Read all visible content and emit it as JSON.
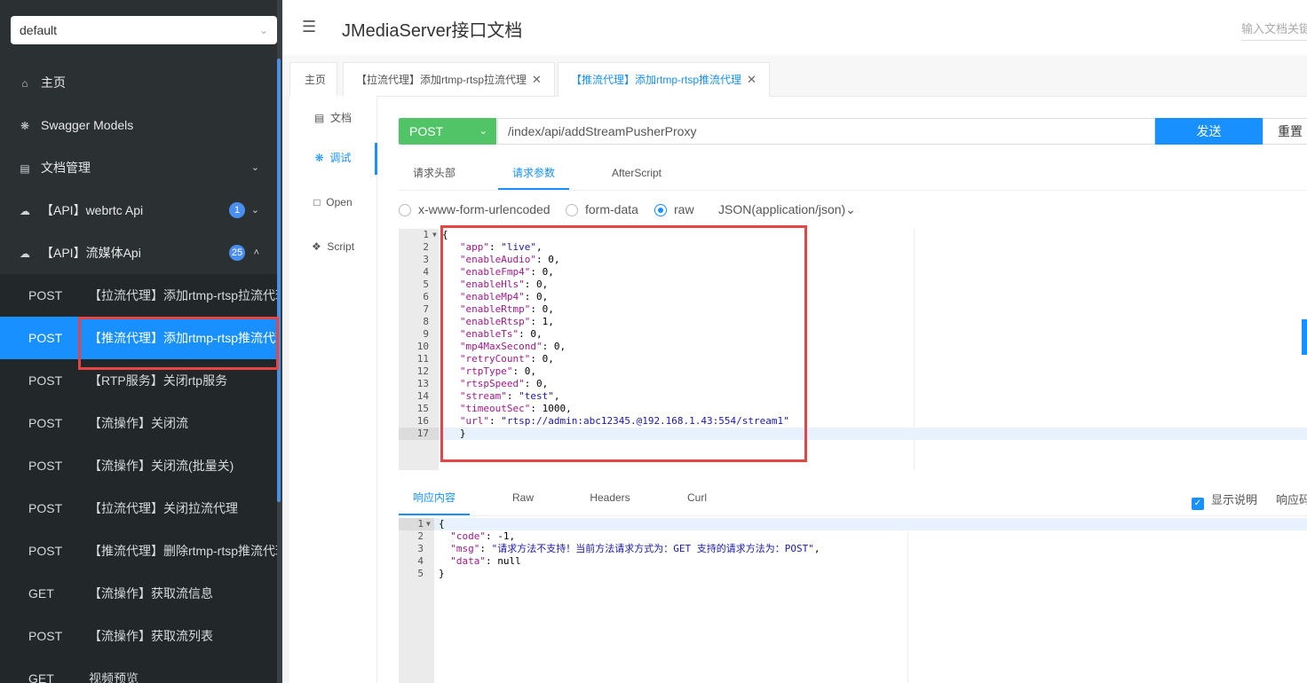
{
  "sidebar": {
    "group_select": "default",
    "menu": [
      {
        "label": "主页",
        "icon": "home-icon"
      },
      {
        "label": "Swagger Models",
        "icon": "cube-icon"
      },
      {
        "label": "文档管理",
        "icon": "doc-manage-icon"
      },
      {
        "label": "【API】webrtc Api",
        "icon": "cloud-icon",
        "badge": "1"
      },
      {
        "label": "【API】流媒体Api",
        "icon": "cloud-icon",
        "badge": "25"
      }
    ],
    "apis": [
      {
        "method": "POST",
        "name": "【拉流代理】添加rtmp-rtsp拉流代理"
      },
      {
        "method": "POST",
        "name": "【推流代理】添加rtmp-rtsp推流代理"
      },
      {
        "method": "POST",
        "name": "【RTP服务】关闭rtp服务"
      },
      {
        "method": "POST",
        "name": "【流操作】关闭流"
      },
      {
        "method": "POST",
        "name": "【流操作】关闭流(批量关)"
      },
      {
        "method": "POST",
        "name": "【拉流代理】关闭拉流代理"
      },
      {
        "method": "POST",
        "name": "【推流代理】删除rtmp-rtsp推流代理"
      },
      {
        "method": "GET",
        "name": "【流操作】获取流信息"
      },
      {
        "method": "POST",
        "name": "【流操作】获取流列表"
      },
      {
        "method": "GET",
        "name": "视频预览"
      }
    ]
  },
  "header": {
    "title": "JMediaServer接口文档",
    "search_placeholder": "输入文档关键字搜索"
  },
  "tabs": [
    {
      "label": "主页"
    },
    {
      "label": "【拉流代理】添加rtmp-rtsp拉流代理"
    },
    {
      "label": "【推流代理】添加rtmp-rtsp推流代理"
    }
  ],
  "leftnav": [
    {
      "label": "文档",
      "icon": "doc-icon"
    },
    {
      "label": "调试",
      "icon": "bug-icon"
    },
    {
      "label": "Open",
      "icon": "file-icon"
    },
    {
      "label": "Script",
      "icon": "code-icon"
    }
  ],
  "request": {
    "method": "POST",
    "url": "/index/api/addStreamPusherProxy",
    "send_label": "发送",
    "reset_label": "重置",
    "subtabs": [
      "请求头部",
      "请求参数",
      "AfterScript"
    ],
    "body_types": [
      "x-www-form-urlencoded",
      "form-data",
      "raw"
    ],
    "content_type": "JSON(application/json)",
    "body": {
      "app": "live",
      "enableAudio": 0,
      "enableFmp4": 0,
      "enableHls": 0,
      "enableMp4": 0,
      "enableRtmp": 0,
      "enableRtsp": 1,
      "enableTs": 0,
      "mp4MaxSecond": 0,
      "retryCount": 0,
      "rtpType": 0,
      "rtspSpeed": 0,
      "stream": "test",
      "timeoutSec": 1000,
      "url": "rtsp://admin:abc12345.@192.168.1.43:554/stream1"
    }
  },
  "response": {
    "tabs": [
      "响应内容",
      "Raw",
      "Headers",
      "Curl"
    ],
    "show_desc_label": "显示说明",
    "more_label": "响应码",
    "body": {
      "code": -1,
      "msg": "请求方法不支持！当前方法请求方式为：GET 支持的请求方法为：POST",
      "data": "null"
    }
  },
  "colors": {
    "sidebar_bg": "#2b3033",
    "accent": "#1890ff",
    "post_green": "#52c468",
    "highlight_box": "#e54545"
  }
}
